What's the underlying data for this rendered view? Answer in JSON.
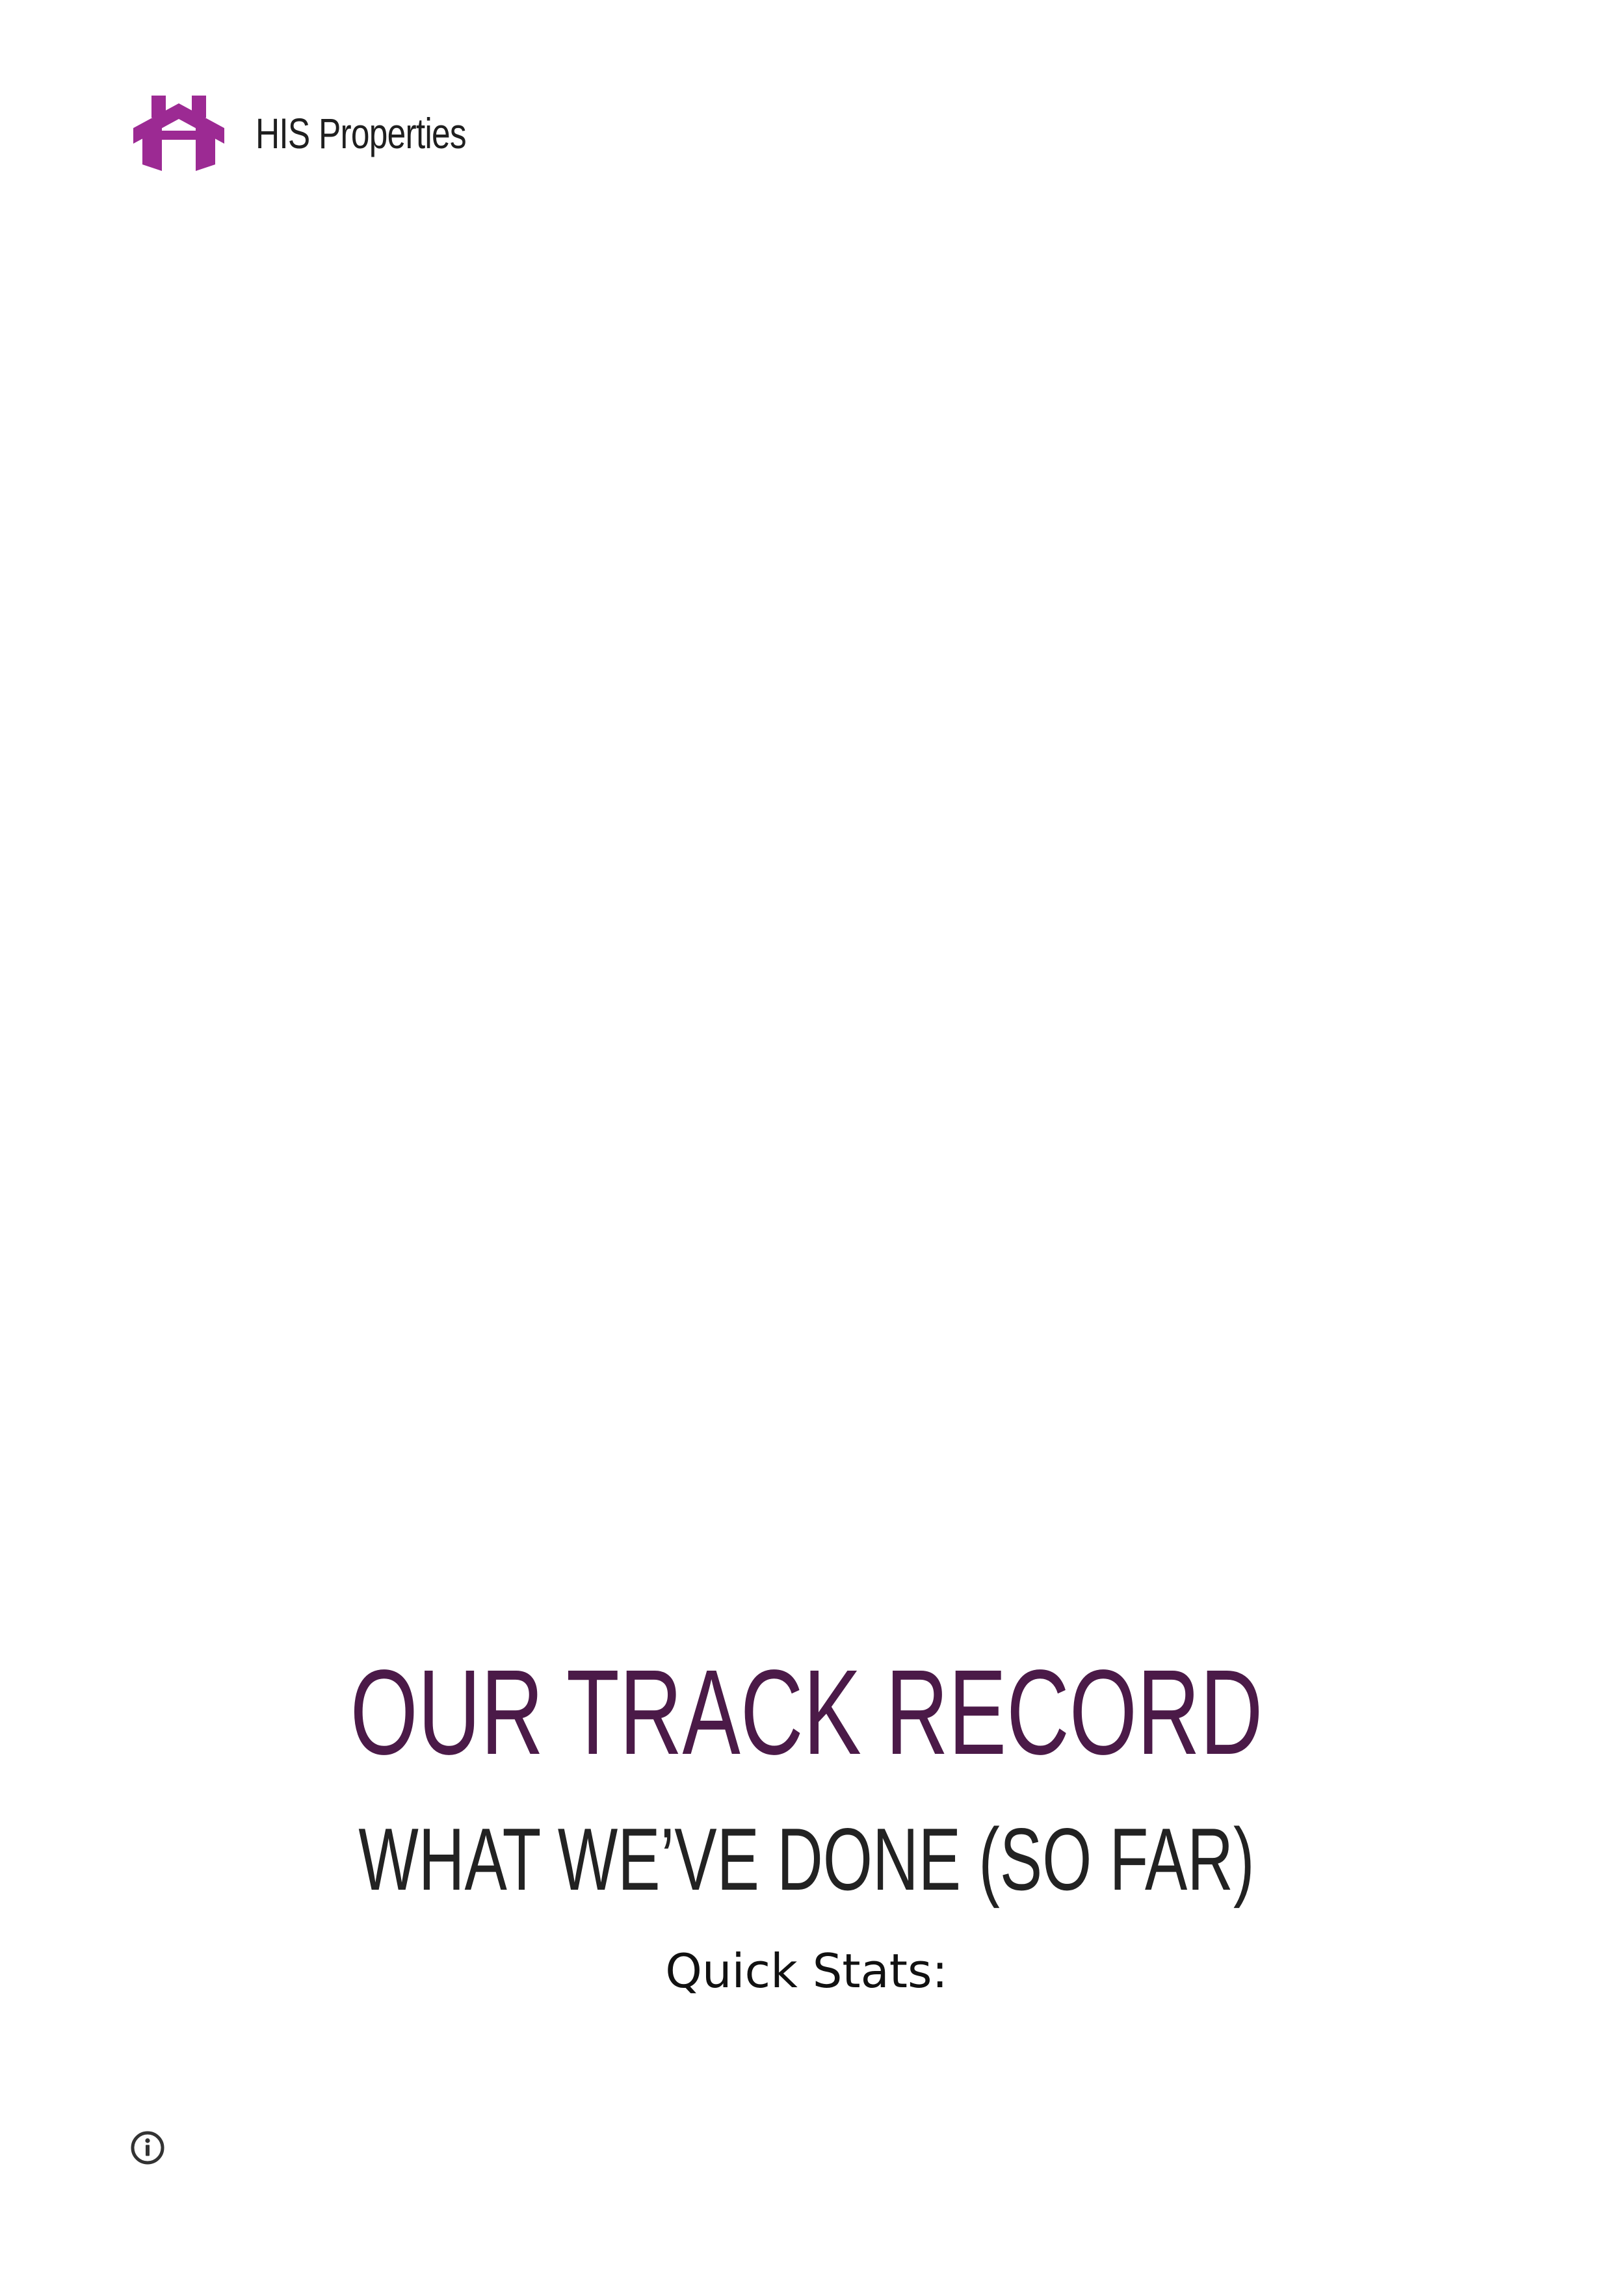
{
  "header": {
    "logo_icon": "house-logo-icon",
    "brand_name": "HIS Properties",
    "brand_color": "#9c2a93"
  },
  "hero": {
    "title": "OUR TRACK RECORD",
    "subtitle": "WHAT WE’VE DONE (SO FAR)",
    "stats_label": "Quick Stats:",
    "title_color": "#4b1a48"
  },
  "footer": {
    "info_icon": "info-icon"
  }
}
